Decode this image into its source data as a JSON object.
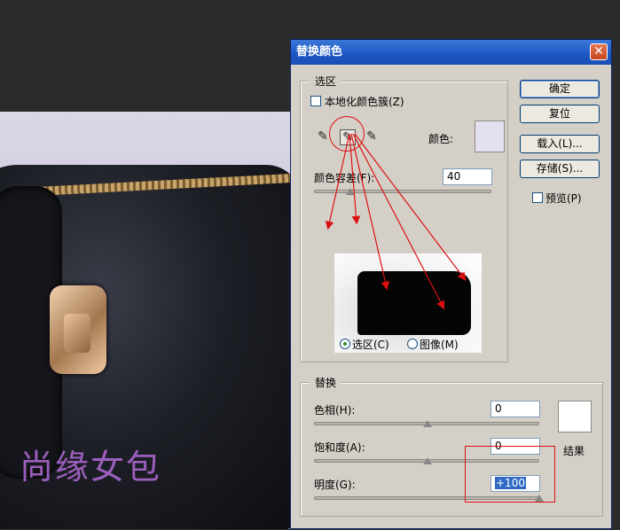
{
  "dialog": {
    "title": "替换颜色",
    "close_glyph": "✕"
  },
  "selection_group": {
    "title": "选区",
    "localized_clusters_label": "本地化颜色簇(Z)",
    "color_label": "颜色:",
    "color_swatch": "#e3e0f2",
    "fuzziness_label": "颜色容差(F):",
    "fuzziness_value": "40",
    "fuzziness_fraction": 0.2,
    "radio_selection_label": "选区(C)",
    "radio_image_label": "图像(M)",
    "radio_selected": "selection"
  },
  "buttons": {
    "ok": "确定",
    "reset": "复位",
    "load": "载入(L)...",
    "save": "存储(S)..."
  },
  "preview_checkbox": {
    "label": "预览(P)"
  },
  "replace_group": {
    "title": "替换",
    "hue_label": "色相(H):",
    "hue_value": "0",
    "hue_fraction": 0.5,
    "saturation_label": "饱和度(A):",
    "saturation_value": "0",
    "saturation_fraction": 0.5,
    "lightness_label": "明度(G):",
    "lightness_value": "+100",
    "lightness_fraction": 1.0,
    "result_label": "结果",
    "result_swatch": "#ffffff"
  },
  "watermark": "尚缘女包",
  "colors": {
    "accent_red": "#dd1111",
    "title_blue": "#1d55c2"
  }
}
